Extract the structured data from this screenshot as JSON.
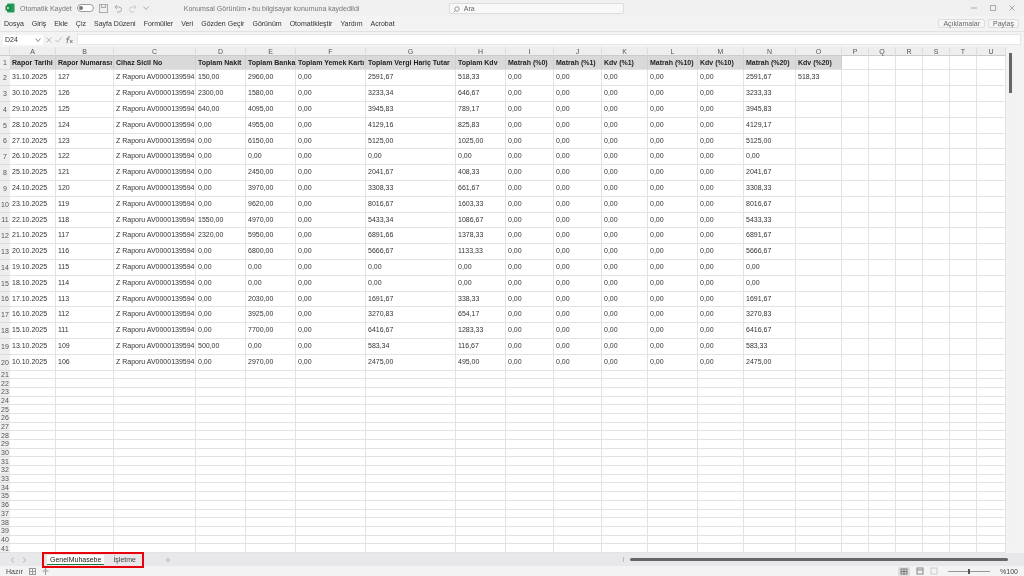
{
  "title_bar": {
    "autosave_label": "Otomatik Kaydet",
    "autosave_on": false,
    "document_title": "Konumsal Görünüm • bu bilgisayar konumuna kaydedildi",
    "search": {
      "placeholder": "Ara"
    }
  },
  "menu": [
    "Dosya",
    "Giriş",
    "Ekle",
    "Çiz",
    "Sayfa Düzeni",
    "Formüller",
    "Veri",
    "Gözden Geçir",
    "Görünüm",
    "Otomatikleştir",
    "Yardım",
    "Acrobat"
  ],
  "ribbon_buttons": [
    "Açıklamalar",
    "Paylaş"
  ],
  "formula_bar": {
    "name_box": "D24"
  },
  "sheet": {
    "columns": [
      "A",
      "B",
      "C",
      "D",
      "E",
      "F",
      "G",
      "H",
      "I",
      "J",
      "K",
      "L",
      "M",
      "N",
      "O",
      "P",
      "Q",
      "R",
      "S",
      "T",
      "U"
    ],
    "rows": [
      {
        "number": "1",
        "kind": "header",
        "cells": [
          "Rapor Tarihi",
          "Rapor Numarası",
          "Cihaz Sicil No",
          "Toplam Nakit",
          "Toplam Banka",
          "Toplam Yemek Kartı",
          "Toplam Vergi Hariç Tutar",
          "Toplam Kdv",
          "Matrah (%0)",
          "Matrah (%1)",
          "Kdv (%1)",
          "Matrah (%10)",
          "Kdv (%10)",
          "Matrah (%20)",
          "Kdv (%20)"
        ]
      },
      {
        "number": "2",
        "kind": "data",
        "cells": [
          "31.10.2025",
          "127",
          "Z Raporu AV0000139594",
          "150,00",
          "2960,00",
          "0,00",
          "2591,67",
          "518,33",
          "0,00",
          "0,00",
          "0,00",
          "0,00",
          "0,00",
          "2591,67",
          "518,33"
        ]
      },
      {
        "number": "3",
        "kind": "data",
        "cells": [
          "30.10.2025",
          "126",
          "Z Raporu AV0000139594",
          "2300,00",
          "1580,00",
          "0,00",
          "3233,34",
          "646,67",
          "0,00",
          "0,00",
          "0,00",
          "0,00",
          "0,00",
          "3233,33"
        ]
      },
      {
        "number": "4",
        "kind": "data",
        "cells": [
          "29.10.2025",
          "125",
          "Z Raporu AV0000139594",
          "640,00",
          "4095,00",
          "0,00",
          "3945,83",
          "789,17",
          "0,00",
          "0,00",
          "0,00",
          "0,00",
          "0,00",
          "3945,83"
        ]
      },
      {
        "number": "5",
        "kind": "data",
        "cells": [
          "28.10.2025",
          "124",
          "Z Raporu AV0000139594",
          "0,00",
          "4955,00",
          "0,00",
          "4129,16",
          "825,83",
          "0,00",
          "0,00",
          "0,00",
          "0,00",
          "0,00",
          "4129,17"
        ]
      },
      {
        "number": "6",
        "kind": "data",
        "cells": [
          "27.10.2025",
          "123",
          "Z Raporu AV0000139594",
          "0,00",
          "6150,00",
          "0,00",
          "5125,00",
          "1025,00",
          "0,00",
          "0,00",
          "0,00",
          "0,00",
          "0,00",
          "5125,00"
        ]
      },
      {
        "number": "7",
        "kind": "data",
        "cells": [
          "26.10.2025",
          "122",
          "Z Raporu AV0000139594",
          "0,00",
          "0,00",
          "0,00",
          "0,00",
          "0,00",
          "0,00",
          "0,00",
          "0,00",
          "0,00",
          "0,00",
          "0,00"
        ]
      },
      {
        "number": "8",
        "kind": "data",
        "cells": [
          "25.10.2025",
          "121",
          "Z Raporu AV0000139594",
          "0,00",
          "2450,00",
          "0,00",
          "2041,67",
          "408,33",
          "0,00",
          "0,00",
          "0,00",
          "0,00",
          "0,00",
          "2041,67"
        ]
      },
      {
        "number": "9",
        "kind": "data",
        "cells": [
          "24.10.2025",
          "120",
          "Z Raporu AV0000139594",
          "0,00",
          "3970,00",
          "0,00",
          "3308,33",
          "661,67",
          "0,00",
          "0,00",
          "0,00",
          "0,00",
          "0,00",
          "3308,33"
        ]
      },
      {
        "number": "10",
        "kind": "data",
        "cells": [
          "23.10.2025",
          "119",
          "Z Raporu AV0000139594",
          "0,00",
          "9620,00",
          "0,00",
          "8016,67",
          "1603,33",
          "0,00",
          "0,00",
          "0,00",
          "0,00",
          "0,00",
          "8016,67"
        ]
      },
      {
        "number": "11",
        "kind": "data",
        "cells": [
          "22.10.2025",
          "118",
          "Z Raporu AV0000139594",
          "1550,00",
          "4970,00",
          "0,00",
          "5433,34",
          "1086,67",
          "0,00",
          "0,00",
          "0,00",
          "0,00",
          "0,00",
          "5433,33"
        ]
      },
      {
        "number": "12",
        "kind": "data",
        "cells": [
          "21.10.2025",
          "117",
          "Z Raporu AV0000139594",
          "2320,00",
          "5950,00",
          "0,00",
          "6891,66",
          "1378,33",
          "0,00",
          "0,00",
          "0,00",
          "0,00",
          "0,00",
          "6891,67"
        ]
      },
      {
        "number": "13",
        "kind": "data",
        "cells": [
          "20.10.2025",
          "116",
          "Z Raporu AV0000139594",
          "0,00",
          "6800,00",
          "0,00",
          "5666,67",
          "1133,33",
          "0,00",
          "0,00",
          "0,00",
          "0,00",
          "0,00",
          "5666,67"
        ]
      },
      {
        "number": "14",
        "kind": "data",
        "cells": [
          "19.10.2025",
          "115",
          "Z Raporu AV0000139594",
          "0,00",
          "0,00",
          "0,00",
          "0,00",
          "0,00",
          "0,00",
          "0,00",
          "0,00",
          "0,00",
          "0,00",
          "0,00"
        ]
      },
      {
        "number": "15",
        "kind": "data",
        "cells": [
          "18.10.2025",
          "114",
          "Z Raporu AV0000139594",
          "0,00",
          "0,00",
          "0,00",
          "0,00",
          "0,00",
          "0,00",
          "0,00",
          "0,00",
          "0,00",
          "0,00",
          "0,00"
        ]
      },
      {
        "number": "16",
        "kind": "data",
        "cells": [
          "17.10.2025",
          "113",
          "Z Raporu AV0000139594",
          "0,00",
          "2030,00",
          "0,00",
          "1691,67",
          "338,33",
          "0,00",
          "0,00",
          "0,00",
          "0,00",
          "0,00",
          "1691,67"
        ]
      },
      {
        "number": "17",
        "kind": "data",
        "cells": [
          "16.10.2025",
          "112",
          "Z Raporu AV0000139594",
          "0,00",
          "3925,00",
          "0,00",
          "3270,83",
          "654,17",
          "0,00",
          "0,00",
          "0,00",
          "0,00",
          "0,00",
          "3270,83"
        ]
      },
      {
        "number": "18",
        "kind": "data",
        "cells": [
          "15.10.2025",
          "111",
          "Z Raporu AV0000139594",
          "0,00",
          "7700,00",
          "0,00",
          "6416,67",
          "1283,33",
          "0,00",
          "0,00",
          "0,00",
          "0,00",
          "0,00",
          "6416,67"
        ]
      },
      {
        "number": "19",
        "kind": "data",
        "cells": [
          "13.10.2025",
          "109",
          "Z Raporu AV0000139594",
          "500,00",
          "0,00",
          "0,00",
          "583,34",
          "116,67",
          "0,00",
          "0,00",
          "0,00",
          "0,00",
          "0,00",
          "583,33"
        ]
      },
      {
        "number": "20",
        "kind": "data",
        "cells": [
          "10.10.2025",
          "106",
          "Z Raporu AV0000139594",
          "0,00",
          "2970,00",
          "0,00",
          "2475,00",
          "495,00",
          "0,00",
          "0,00",
          "0,00",
          "0,00",
          "0,00",
          "2475,00"
        ]
      }
    ],
    "empty_rows": [
      "21",
      "22",
      "23",
      "24",
      "25",
      "26",
      "27",
      "28",
      "29",
      "30",
      "31",
      "32",
      "33",
      "34",
      "35",
      "36",
      "37",
      "38",
      "39",
      "40",
      "41"
    ]
  },
  "sheet_tabs": [
    {
      "label": "GenelMuhasebe",
      "selected": true
    },
    {
      "label": "İşletme",
      "selected": false
    }
  ],
  "tabs_highlighted": true,
  "status_bar": {
    "status": "Hazır",
    "zoom_slider": {
      "level": 0.5
    },
    "zoom": "%100"
  }
}
